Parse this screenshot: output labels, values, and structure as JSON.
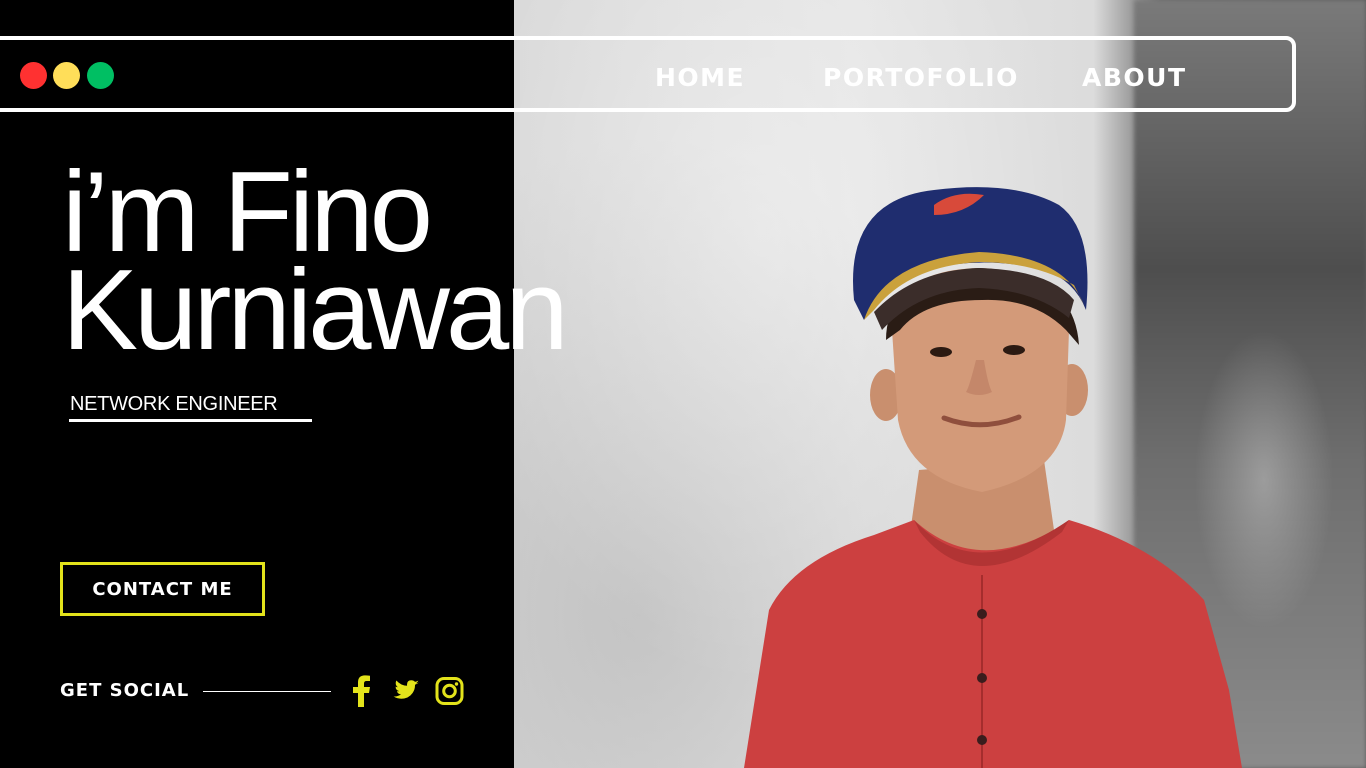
{
  "window": {
    "controls": [
      "close",
      "minimize",
      "maximize"
    ],
    "colors": {
      "close": "#ff3131",
      "minimize": "#ffde59",
      "maximize": "#00bf63"
    }
  },
  "nav": {
    "items": [
      {
        "label": "HOME"
      },
      {
        "label": "PORTOFOLIO"
      },
      {
        "label": "ABOUT"
      }
    ]
  },
  "hero": {
    "headline_line1": "i’m Fino",
    "headline_line2": "Kurniawan",
    "role": "NETWORK ENGINEER",
    "cta_label": "CONTACT ME"
  },
  "social": {
    "label": "GET SOCIAL",
    "icons": [
      "facebook-icon",
      "twitter-icon",
      "instagram-icon"
    ],
    "icon_color": "#e3e31b"
  },
  "colors": {
    "background": "#000000",
    "accent": "#e3e31b",
    "text": "#ffffff"
  }
}
